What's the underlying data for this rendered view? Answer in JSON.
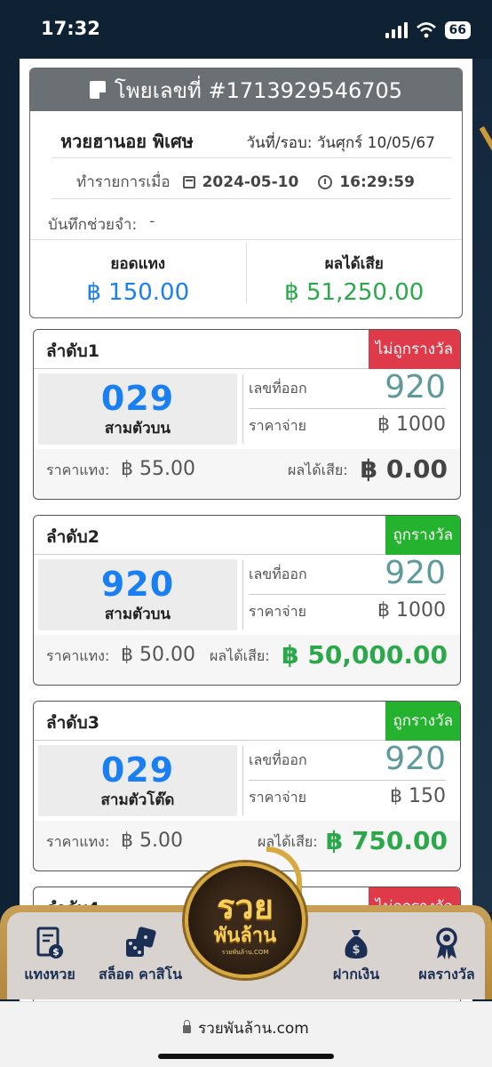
{
  "status_bar": {
    "time": "17:32",
    "battery": "66"
  },
  "bill": {
    "title": "โพยเลขที่ #1713929546705",
    "lottery_name": "หวยฮานอย พิเศษ",
    "round_label": "วันที่/รอบ: วันศุกร์ 10/05/67",
    "transaction_label": "ทำรายการเมื่อ",
    "date": "2024-05-10",
    "time": "16:29:59",
    "memo_label": "บันทึกช่วยจำ:",
    "memo_value": "-",
    "total_bet_label": "ยอดแทง",
    "total_bet_value": "฿ 150.00",
    "total_result_label": "ผลได้เสีย",
    "total_result_value": "฿ 51,250.00"
  },
  "bets": [
    {
      "order": "ลำดับ1",
      "status": "ไม่ถูกรางวัล",
      "number": "029",
      "bet_type": "สามตัวบน",
      "drawn_label": "เลขที่ออก",
      "drawn": "920",
      "payout_label": "ราคาจ่าย",
      "payout": "฿ 1000",
      "stake_label": "ราคาแทง:",
      "stake": "฿ 55.00",
      "result_label": "ผลได้เสีย:",
      "result": "฿ 0.00"
    },
    {
      "order": "ลำดับ2",
      "status": "ถูกรางวัล",
      "number": "920",
      "bet_type": "สามตัวบน",
      "drawn_label": "เลขที่ออก",
      "drawn": "920",
      "payout_label": "ราคาจ่าย",
      "payout": "฿ 1000",
      "stake_label": "ราคาแทง:",
      "stake": "฿ 50.00",
      "result_label": "ผลได้เสีย:",
      "result": "฿ 50,000.00"
    },
    {
      "order": "ลำดับ3",
      "status": "ถูกรางวัล",
      "number": "029",
      "bet_type": "สามตัวโต๊ด",
      "drawn_label": "เลขที่ออก",
      "drawn": "920",
      "payout_label": "ราคาจ่าย",
      "payout": "฿ 150",
      "stake_label": "ราคาแทง:",
      "stake": "฿ 5.00",
      "result_label": "ผลได้เสีย:",
      "result": "฿ 750.00"
    },
    {
      "order": "ลำดับ4",
      "status": "ไม่ถูกรางวัล"
    }
  ],
  "bottom_nav": {
    "items": [
      {
        "label": "แทงหวย",
        "icon": "lottery-ticket-icon"
      },
      {
        "label": "สล็อต คาสิโน",
        "icon": "dice-icon"
      },
      {
        "label": "ฝากเงิน",
        "icon": "money-bag-icon"
      },
      {
        "label": "ผลรางวัล",
        "icon": "award-ribbon-icon"
      }
    ],
    "logo_line1": "รวย",
    "logo_line2": "พันล้าน",
    "logo_small": "รวยพันล้าน.COM"
  },
  "browser": {
    "url": "รวยพันล้าน.com"
  },
  "colors": {
    "blue": "#1a7ff0",
    "green": "#2aa84a",
    "lose_badge": "#de3a4a",
    "win_badge": "#25b22e",
    "gold": "#d7a93e"
  }
}
